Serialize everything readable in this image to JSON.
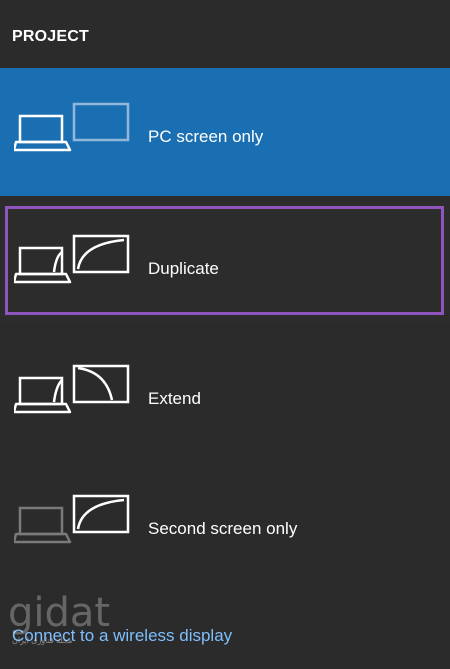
{
  "header": {
    "title": "PROJECT"
  },
  "options": [
    {
      "label": "PC screen only",
      "icon": "pc-screen-only-icon",
      "state": "selected"
    },
    {
      "label": "Duplicate",
      "icon": "duplicate-icon",
      "state": "focused"
    },
    {
      "label": "Extend",
      "icon": "extend-icon",
      "state": "normal"
    },
    {
      "label": "Second screen only",
      "icon": "second-screen-only-icon",
      "state": "normal"
    }
  ],
  "footer": {
    "wireless_link": "Connect to a wireless display"
  },
  "watermark": {
    "logo": "gidat",
    "subtitle": "مجله فناوری ایران"
  },
  "colors": {
    "background": "#2b2b2b",
    "selected": "#1a6fb3",
    "focus_ring": "#9055bd",
    "link": "#7fbfff"
  }
}
